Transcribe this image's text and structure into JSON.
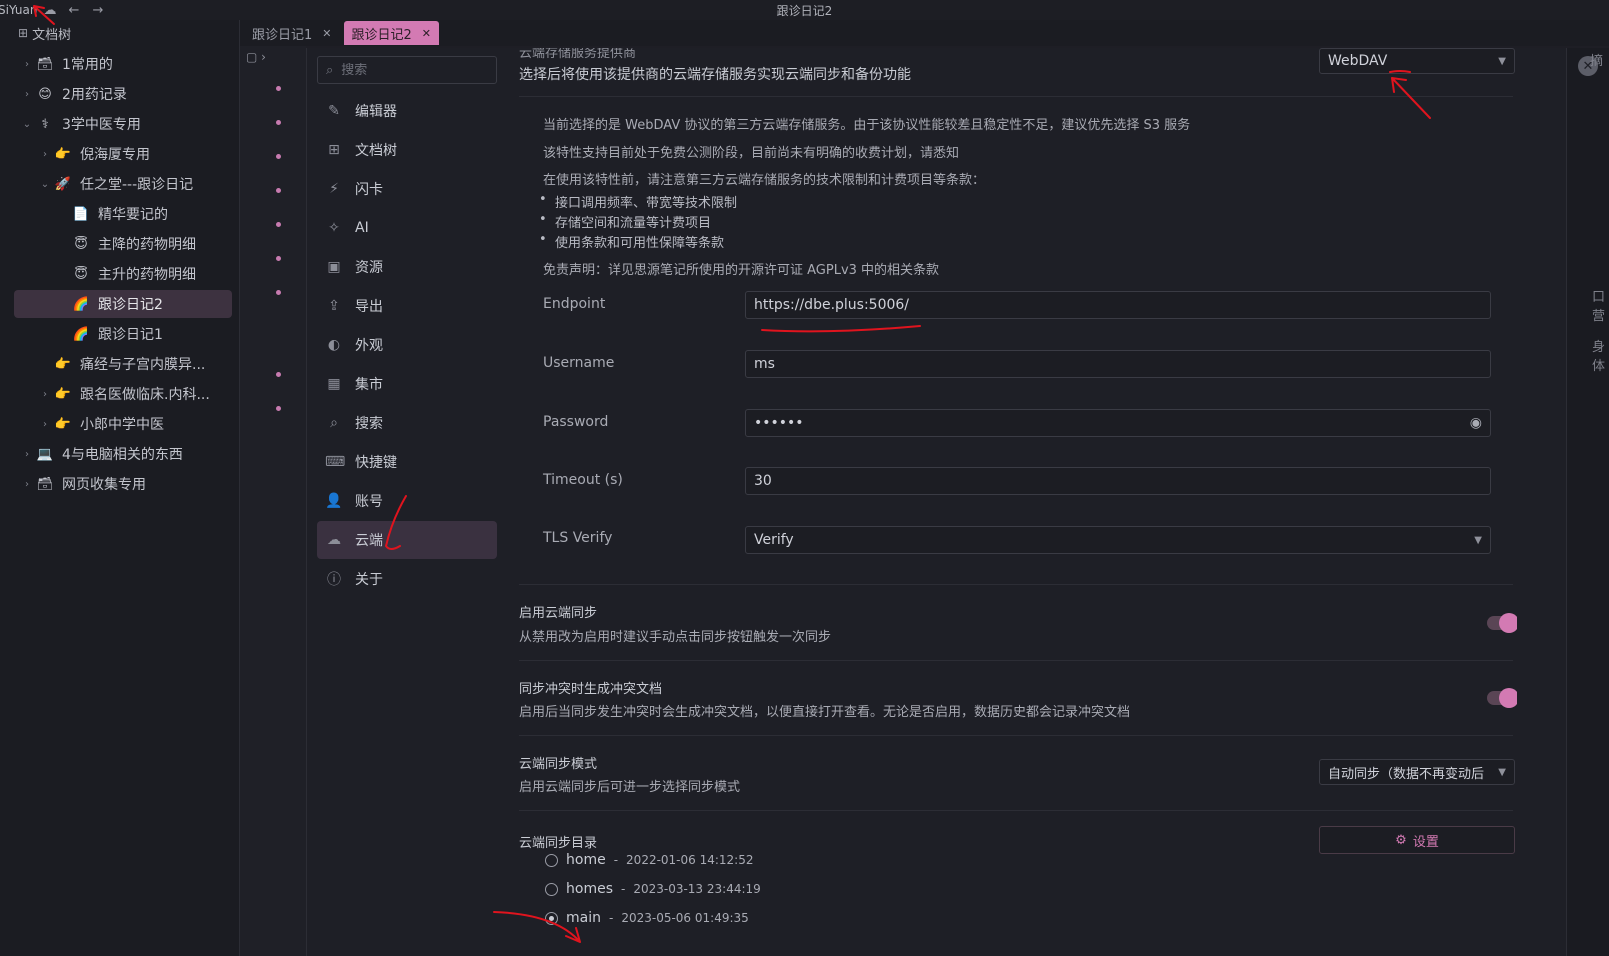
{
  "window": {
    "brand": "SiYuan",
    "title": "跟诊日记2"
  },
  "sidebar": {
    "header": "文档树",
    "items": [
      {
        "label": "1常用的",
        "emoji": "🗃",
        "arrow": "›",
        "indent": 0
      },
      {
        "label": "2用药记录",
        "emoji": "😊",
        "arrow": "›",
        "indent": 0
      },
      {
        "label": "3学中医专用",
        "emoji": "⚕",
        "arrow": "⌄",
        "indent": 0
      },
      {
        "label": "倪海厦专用",
        "emoji": "👉",
        "arrow": "›",
        "indent": 1
      },
      {
        "label": "任之堂---跟诊日记",
        "emoji": "🚀",
        "arrow": "⌄",
        "indent": 1
      },
      {
        "label": "精华要记的",
        "emoji": "📄",
        "arrow": "",
        "indent": 2
      },
      {
        "label": "主降的药物明细",
        "emoji": "😇",
        "arrow": "",
        "indent": 2
      },
      {
        "label": "主升的药物明细",
        "emoji": "😇",
        "arrow": "",
        "indent": 2
      },
      {
        "label": "跟诊日记2",
        "emoji": "🌈",
        "arrow": "",
        "indent": 2,
        "active": true
      },
      {
        "label": "跟诊日记1",
        "emoji": "🌈",
        "arrow": "",
        "indent": 2
      },
      {
        "label": "痛经与子宫内膜异...",
        "emoji": "👉",
        "arrow": "",
        "indent": 1
      },
      {
        "label": "跟名医做临床.内科...",
        "emoji": "👉",
        "arrow": "›",
        "indent": 1
      },
      {
        "label": "小郎中学中医",
        "emoji": "👉",
        "arrow": "›",
        "indent": 1
      },
      {
        "label": "4与电脑相关的东西",
        "emoji": "💻",
        "arrow": "›",
        "indent": 0
      },
      {
        "label": "网页收集专用",
        "emoji": "🗃",
        "arrow": "›",
        "indent": 0
      }
    ]
  },
  "tabs": [
    {
      "label": "跟诊日记1",
      "active": false
    },
    {
      "label": "跟诊日记2",
      "active": true
    }
  ],
  "settings": {
    "search_placeholder": "搜索",
    "nav": [
      {
        "label": "编辑器",
        "icon": "✎"
      },
      {
        "label": "文档树",
        "icon": "⊞"
      },
      {
        "label": "闪卡",
        "icon": "⚡"
      },
      {
        "label": "AI",
        "icon": "✧"
      },
      {
        "label": "资源",
        "icon": "▣"
      },
      {
        "label": "导出",
        "icon": "⇪"
      },
      {
        "label": "外观",
        "icon": "◐"
      },
      {
        "label": "集市",
        "icon": "▦"
      },
      {
        "label": "搜索",
        "icon": "⌕"
      },
      {
        "label": "快捷键",
        "icon": "⌨"
      },
      {
        "label": "账号",
        "icon": "👤"
      },
      {
        "label": "云端",
        "icon": "☁",
        "active": true
      },
      {
        "label": "关于",
        "icon": "ⓘ"
      }
    ],
    "provider": {
      "title_cut": "云端存储服务提供商",
      "desc": "选择后将使用该提供商的云端存储服务实现云端同步和备份功能",
      "selected": "WebDAV"
    },
    "notice": {
      "line1": "当前选择的是 WebDAV 协议的第三方云端存储服务。由于该协议性能较差且稳定性不足，建议优先选择 S3 服务",
      "line2": "该特性支持目前处于免费公测阶段，目前尚未有明确的收费计划，请悉知",
      "line3": "在使用该特性前，请注意第三方云端存储服务的技术限制和计费项目等条款：",
      "bullets": [
        "接口调用频率、带宽等技术限制",
        "存储空间和流量等计费项目",
        "使用条款和可用性保障等条款"
      ],
      "disclaimer": "免责声明：详见思源笔记所使用的开源许可证 AGPLv3 中的相关条款"
    },
    "fields": {
      "endpoint_label": "Endpoint",
      "endpoint_value": "https://dbe.plus:5006/",
      "username_label": "Username",
      "username_value": "ms",
      "password_label": "Password",
      "password_value": "••••••",
      "timeout_label": "Timeout (s)",
      "timeout_value": "30",
      "tls_label": "TLS Verify",
      "tls_value": "Verify"
    },
    "sync_enable": {
      "title": "启用云端同步",
      "desc": "从禁用改为启用时建议手动点击同步按钮触发一次同步",
      "on": true
    },
    "conflict": {
      "title": "同步冲突时生成冲突文档",
      "desc": "启用后当同步发生冲突时会生成冲突文档，以便直接打开查看。无论是否启用，数据历史都会记录冲突文档",
      "on": true
    },
    "sync_mode": {
      "title": "云端同步模式",
      "desc": "启用云端同步后可进一步选择同步模式",
      "selected": "自动同步（数据不再变动后"
    },
    "sync_dir": {
      "title": "云端同步目录",
      "button": "设置",
      "dirs": [
        {
          "name": "home",
          "time": "2022-01-06 14:12:52",
          "checked": false
        },
        {
          "name": "homes",
          "time": "2023-03-13 23:44:19",
          "checked": false
        },
        {
          "name": "main",
          "time": "2023-05-06 01:49:35",
          "checked": true
        }
      ]
    }
  },
  "edge_text": {
    "a": "摘",
    "b": "口营",
    "c": "身体"
  },
  "colors": {
    "accent": "#d37ab3",
    "background": "#1e1f26",
    "annotation": "#e0141e"
  }
}
